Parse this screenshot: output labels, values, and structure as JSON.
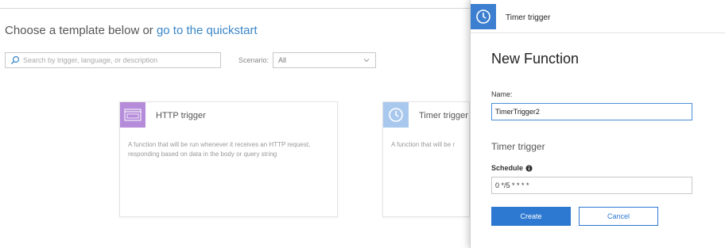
{
  "templates_page": {
    "heading_prefix": "Choose a template below or",
    "heading_link": "go to the quickstart",
    "search": {
      "placeholder": "Search by trigger, language, or description"
    },
    "scenario": {
      "label": "Scenario:",
      "value": "All"
    },
    "cards": [
      {
        "title": "HTTP trigger",
        "icon": "http-icon",
        "icon_color": "#b58cda",
        "description": "A function that will be run whenever it receives an HTTP request, responding based on data in the body or query string"
      },
      {
        "title": "Timer trigger",
        "icon": "clock-icon",
        "icon_color": "#a9c8ee",
        "description": "A function that will be r"
      }
    ]
  },
  "panel": {
    "header_icon": "clock-icon",
    "header_icon_color": "#3c7fd0",
    "header_title": "Timer trigger",
    "title": "New Function",
    "name_label": "Name:",
    "name_value": "TimerTrigger2",
    "section_title": "Timer trigger",
    "schedule_label": "Schedule",
    "schedule_info_icon": "info-icon",
    "schedule_value": "0 */5 * * * *",
    "create_label": "Create",
    "cancel_label": "Cancel"
  },
  "colors": {
    "accent": "#2d78d0",
    "link": "#3a86c8"
  }
}
